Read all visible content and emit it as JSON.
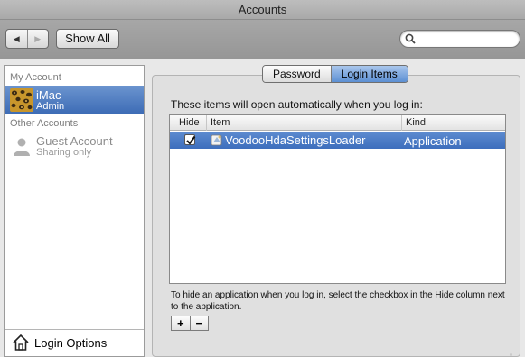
{
  "window": {
    "title": "Accounts"
  },
  "toolbar": {
    "back_icon": "back-arrow-icon",
    "forward_icon": "forward-arrow-icon",
    "show_all_label": "Show All",
    "search": {
      "value": "",
      "placeholder": ""
    }
  },
  "sidebar": {
    "my_account_header": "My Account",
    "current_user": {
      "name": "iMac",
      "role": "Admin",
      "selected": true
    },
    "other_accounts_header": "Other Accounts",
    "guest": {
      "name": "Guest Account",
      "status": "Sharing only"
    },
    "footer_label": "Login Options"
  },
  "tabs": [
    {
      "label": "Password",
      "active": false
    },
    {
      "label": "Login Items",
      "active": true
    }
  ],
  "login_items": {
    "intro": "These items will open automatically when you log in:",
    "columns": {
      "hide": "Hide",
      "item": "Item",
      "kind": "Kind"
    },
    "rows": [
      {
        "hide": true,
        "item": "VoodooHdaSettingsLoader",
        "kind": "Application",
        "selected": true
      }
    ],
    "help_text": "To hide an application when you log in, select the checkbox in the Hide column next to the application.",
    "add_label": "+",
    "remove_label": "−"
  },
  "colors": {
    "selection": "#3d6ebd",
    "active_tab": "#5c8fd3"
  }
}
